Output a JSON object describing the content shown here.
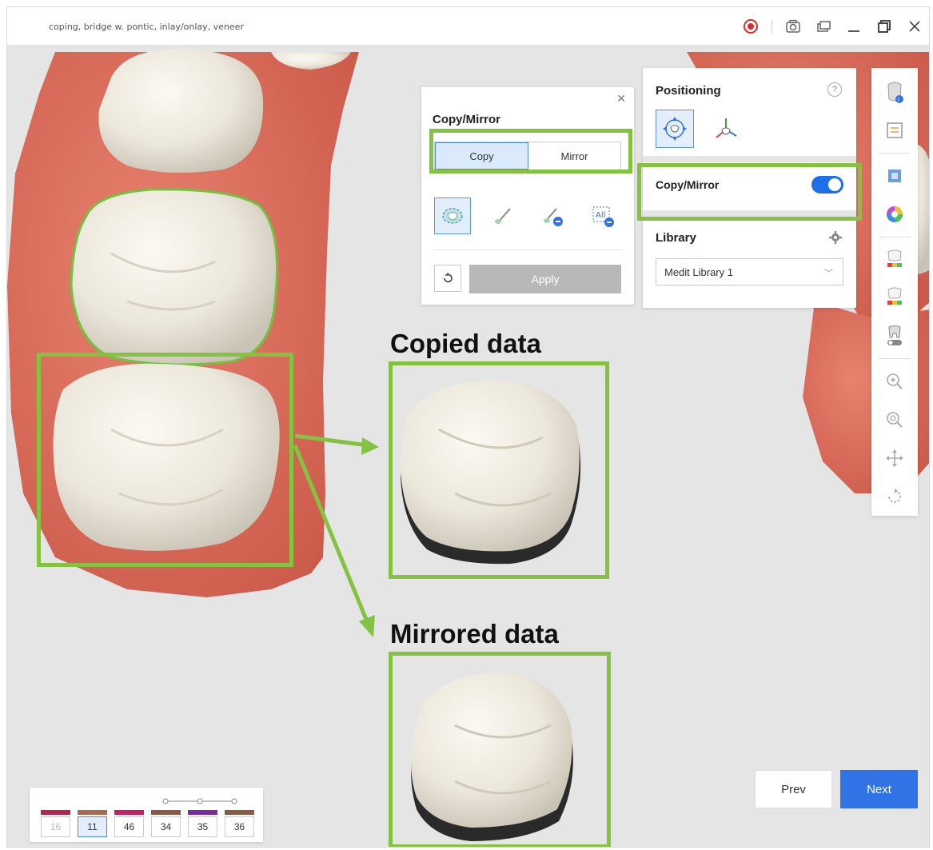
{
  "window": {
    "title": "coping, bridge w. pontic, inlay/onlay, veneer"
  },
  "colors": {
    "accent": "#2f73e6",
    "highlight": "#83c341",
    "gum": "#d9695a",
    "tooth": "#f1ede2"
  },
  "copy_mirror_panel": {
    "title": "Copy/Mirror",
    "tabs": [
      {
        "label": "Copy",
        "active": true
      },
      {
        "label": "Mirror",
        "active": false
      }
    ],
    "apply_label": "Apply"
  },
  "positioning": {
    "title": "Positioning",
    "help": "?"
  },
  "copy_mirror_toggle": {
    "label": "Copy/Mirror",
    "on": true
  },
  "library": {
    "title": "Library",
    "selected": "Medit Library 1"
  },
  "callouts": {
    "copied": "Copied data",
    "mirrored": "Mirrored data"
  },
  "tooth_tray": {
    "items": [
      {
        "num": "16",
        "color": "#b5234f",
        "selected": false,
        "dim": true
      },
      {
        "num": "11",
        "color": "#a86a55",
        "selected": true,
        "dim": false
      },
      {
        "num": "46",
        "color": "#c81f63",
        "selected": false,
        "dim": false
      },
      {
        "num": "34",
        "color": "#8a5a48",
        "selected": false,
        "dim": false
      },
      {
        "num": "35",
        "color": "#7b2aa0",
        "selected": false,
        "dim": false
      },
      {
        "num": "36",
        "color": "#8a5a48",
        "selected": false,
        "dim": false
      }
    ]
  },
  "nav": {
    "prev": "Prev",
    "next": "Next"
  }
}
